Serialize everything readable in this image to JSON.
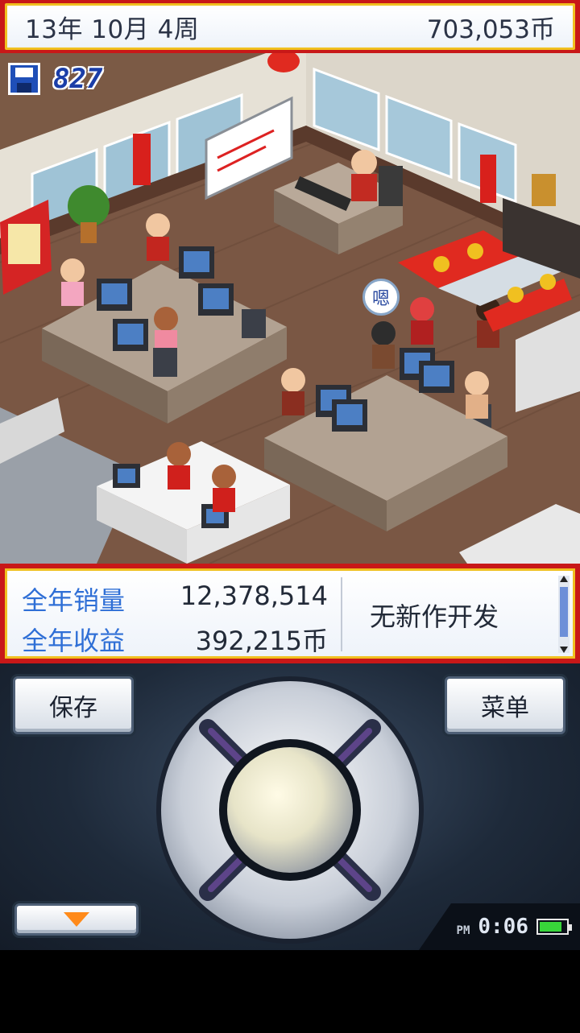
{
  "status_bar": {
    "date": "13年 10月 4周",
    "money": "703,053币"
  },
  "hud": {
    "save_count": "827",
    "speech_bubble": "嗯"
  },
  "info_panel": {
    "annual_sales_label": "全年销量",
    "annual_sales_value": "12,378,514",
    "annual_revenue_label": "全年收益",
    "annual_revenue_value": "392,215币",
    "development_status": "无新作开发"
  },
  "controls": {
    "save_label": "保存",
    "menu_label": "菜单"
  },
  "system": {
    "ampm": "PM",
    "time": "0:06",
    "battery_level": 0.85,
    "battery_color": "#38d63a"
  },
  "colors": {
    "frame_red": "#c81818",
    "frame_gold": "#f0c020",
    "label_blue": "#2f6fd6"
  }
}
